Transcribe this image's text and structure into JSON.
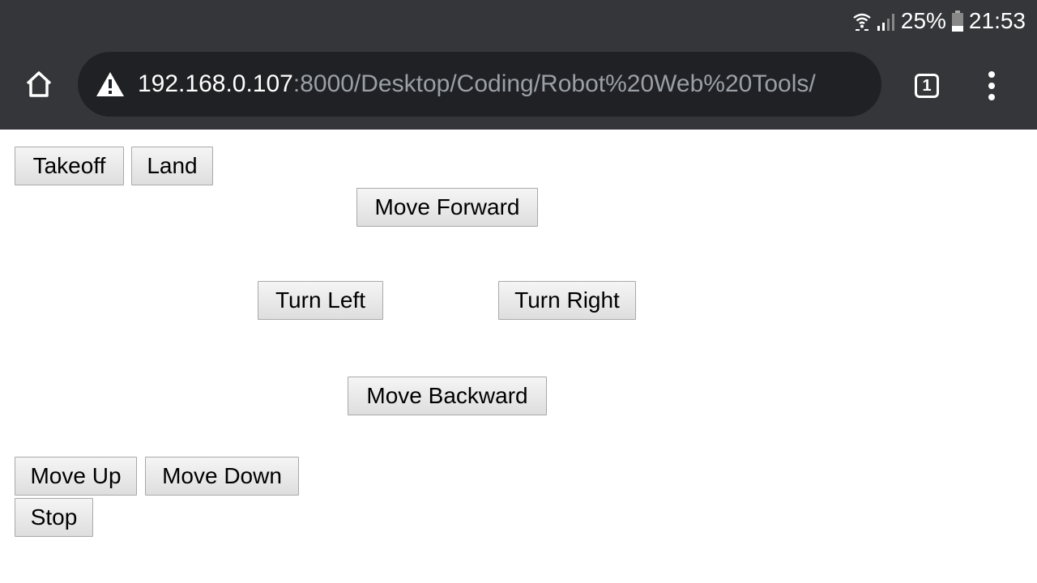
{
  "status_bar": {
    "battery_percent": "25%",
    "time": "21:53",
    "icons": [
      "wifi-icon",
      "signal-icon",
      "battery-icon"
    ]
  },
  "toolbar": {
    "home_icon": "home-icon",
    "warning_icon": "warning-icon",
    "url_host": "192.168.0.107",
    "url_path": ":8000/Desktop/Coding/Robot%20Web%20Tools/",
    "tab_count": "1",
    "menu_icon": "kebab-menu-icon"
  },
  "controls": {
    "takeoff": "Takeoff",
    "land": "Land",
    "move_forward": "Move Forward",
    "turn_left": "Turn Left",
    "turn_right": "Turn Right",
    "move_backward": "Move Backward",
    "move_up": "Move Up",
    "move_down": "Move Down",
    "stop": "Stop"
  },
  "colors": {
    "chrome_bg": "#35363a",
    "omnibox_bg": "#202124",
    "url_path": "#9aa0a6"
  }
}
